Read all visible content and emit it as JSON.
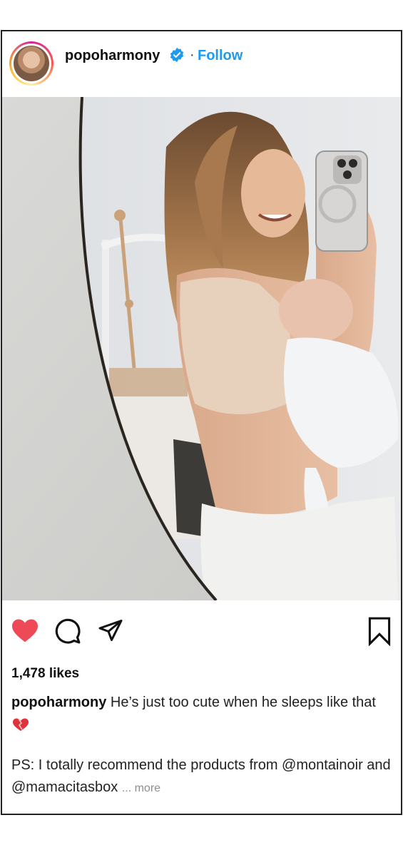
{
  "post": {
    "username": "popoharmony",
    "separator": "·",
    "follow_label": "Follow",
    "avatar_icon": "profile-avatar",
    "verified_icon": "verified-badge-icon",
    "accent_color": "#1c9bf0",
    "like_color": "#ed4956"
  },
  "actions": {
    "like_icon": "heart-filled-icon",
    "comment_icon": "comment-icon",
    "share_icon": "send-icon",
    "save_icon": "bookmark-icon"
  },
  "likes_text": "1,478 likes",
  "caption": {
    "username": "popoharmony",
    "text": "He’s just too cute when he sleeps like that",
    "emoji_icon": "sparkling-heart-emoji",
    "ps_line": "PS: I totally recommend the products from @montainoir and @mamacitasbox",
    "more_label": "... more"
  }
}
